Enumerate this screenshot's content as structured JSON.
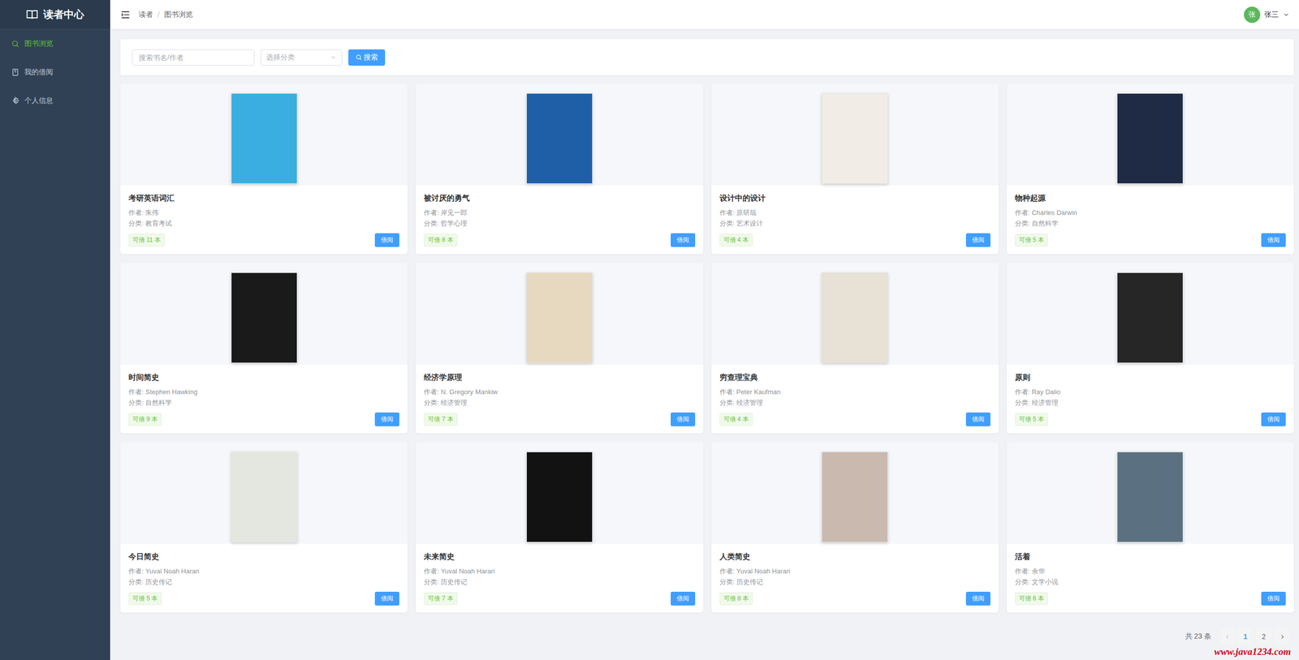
{
  "sidebar": {
    "title": "读者中心",
    "items": [
      {
        "label": "图书浏览",
        "icon": "search",
        "selected": true
      },
      {
        "label": "我的借阅",
        "icon": "book",
        "selected": false
      },
      {
        "label": "个人信息",
        "icon": "gear",
        "selected": false
      }
    ]
  },
  "header": {
    "breadcrumb": [
      "读者",
      "图书浏览"
    ],
    "separator": "/",
    "user": {
      "avatar": "张",
      "name": "张三"
    }
  },
  "search": {
    "placeholder": "搜索书名/作者",
    "category_placeholder": "选择分类",
    "button": "搜索"
  },
  "borrow_button": "借阅",
  "books": [
    {
      "title": "考研英语词汇",
      "author": "作者: 朱伟",
      "category": "分类: 教育考试",
      "stock": "可借 11 本",
      "color": "#3aaee0"
    },
    {
      "title": "被讨厌的勇气",
      "author": "作者: 岸见一郎",
      "category": "分类: 哲学心理",
      "stock": "可借 8 本",
      "color": "#1e5fa8"
    },
    {
      "title": "设计中的设计",
      "author": "作者: 原研哉",
      "category": "分类: 艺术设计",
      "stock": "可借 4 本",
      "color": "#f1ede6"
    },
    {
      "title": "物种起源",
      "author": "作者: Charles Darwin",
      "category": "分类: 自然科学",
      "stock": "可借 5 本",
      "color": "#1f2a44"
    },
    {
      "title": "时间简史",
      "author": "作者: Stephen Hawking",
      "category": "分类: 自然科学",
      "stock": "可借 9 本",
      "color": "#1a1a1a"
    },
    {
      "title": "经济学原理",
      "author": "作者: N. Gregory Mankiw",
      "category": "分类: 经济管理",
      "stock": "可借 7 本",
      "color": "#e6d9c0"
    },
    {
      "title": "穷查理宝典",
      "author": "作者: Peter Kaufman",
      "category": "分类: 经济管理",
      "stock": "可借 4 本",
      "color": "#e7e1d6"
    },
    {
      "title": "原则",
      "author": "作者: Ray Dalio",
      "category": "分类: 经济管理",
      "stock": "可借 5 本",
      "color": "#262626"
    },
    {
      "title": "今日简史",
      "author": "作者: Yuval Noah Harari",
      "category": "分类: 历史传记",
      "stock": "可借 5 本",
      "color": "#e4e7e0"
    },
    {
      "title": "未来简史",
      "author": "作者: Yuval Noah Harari",
      "category": "分类: 历史传记",
      "stock": "可借 7 本",
      "color": "#121212"
    },
    {
      "title": "人类简史",
      "author": "作者: Yuval Noah Harari",
      "category": "分类: 历史传记",
      "stock": "可借 8 本",
      "color": "#c9b9ae"
    },
    {
      "title": "活着",
      "author": "作者: 余华",
      "category": "分类: 文学小说",
      "stock": "可借 6 本",
      "color": "#5b7181"
    }
  ],
  "pagination": {
    "total": "共 23 条",
    "prev_disabled": true,
    "next_disabled": false,
    "pages": [
      {
        "label": "1",
        "selected": true
      },
      {
        "label": "2",
        "selected": false
      }
    ]
  },
  "watermark": "www.java1234.com"
}
